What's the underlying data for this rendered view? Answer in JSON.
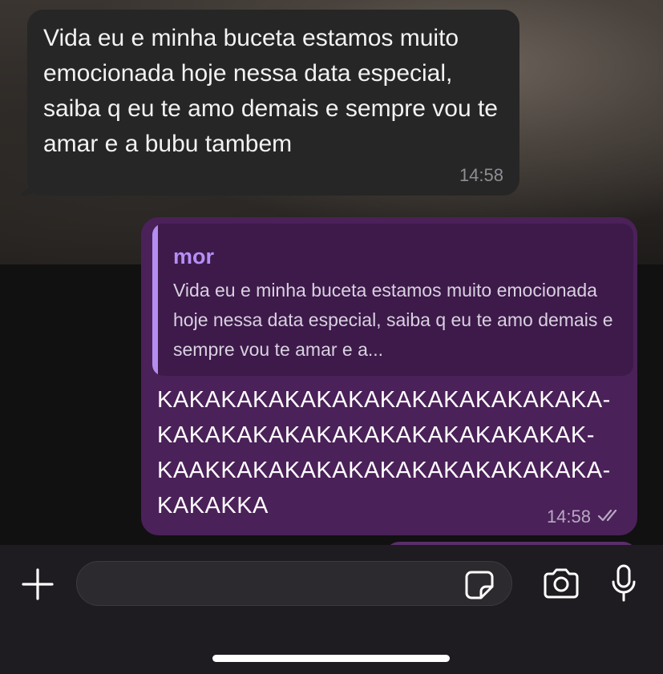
{
  "incoming_message": {
    "text": "Vida eu e minha buceta estamos muito emocionada hoje nessa data especial, saiba q eu te amo demais e sempre vou te amar e a bubu tambem",
    "time": "14:58"
  },
  "outgoing_message": {
    "reply": {
      "author": "mor",
      "quoted_text": "Vida eu e minha buceta estamos muito emocionada hoje nessa data especial, saiba q eu te amo demais e sempre vou te amar e a..."
    },
    "text_lines": [
      "KAKAKAKAKAKAKAKAKAKAKAKAKAKA-",
      "KAKAKAKAKAKAKAKAKAKAKAKAKAK-",
      "KAAKKAKAKAKAKAKAKAKAKAKAKAKA-",
      "KAKAKKA"
    ],
    "time": "14:58",
    "status": "read-double-check"
  },
  "composer": {
    "placeholder": ""
  },
  "icons": {
    "attach": "plus-icon",
    "sticker": "sticker-icon",
    "camera": "camera-icon",
    "microphone": "microphone-icon"
  },
  "colors": {
    "incoming_bubble": "#262626",
    "outgoing_bubble": "#4b2159",
    "reply_accent": "#b48df0"
  }
}
